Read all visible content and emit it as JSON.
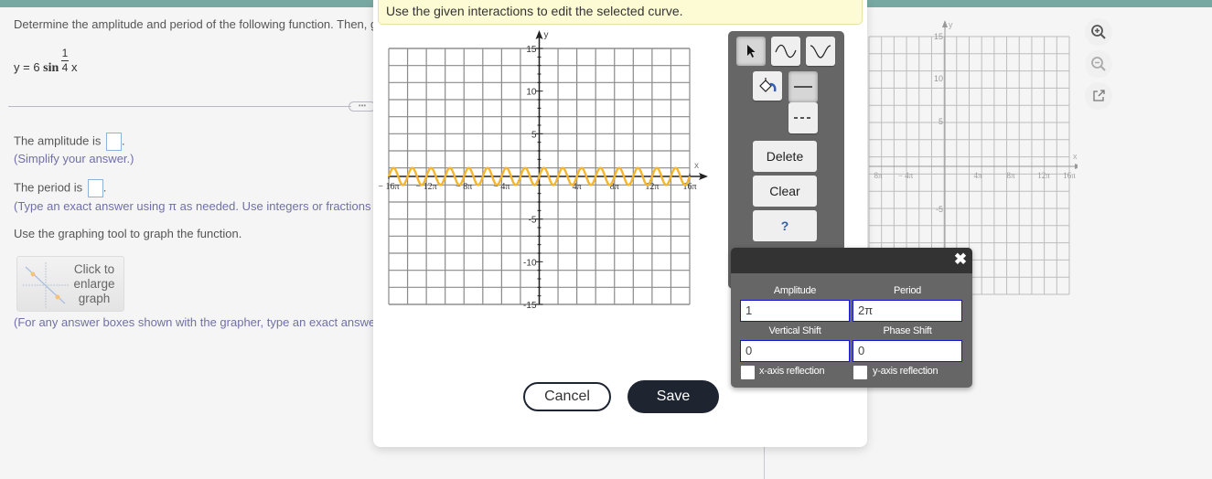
{
  "question": {
    "prompt": "Determine the amplitude and period of the following function. Then, g",
    "equation": {
      "prefix": "y = 6 ",
      "func": "sin",
      "numerator": "1",
      "denominator": "4",
      "variable": "x"
    },
    "amplitude_label": "The amplitude is",
    "amplitude_value": "",
    "amplitude_hint": "(Simplify your answer.)",
    "period_label": "The period is",
    "period_value": "",
    "period_hint": "(Type an exact answer using π as needed. Use integers or fractions",
    "graph_instruction": "Use the graphing tool to graph the function.",
    "enlarge_label": [
      "Click to",
      "enlarge",
      "graph"
    ],
    "grapher_hint": "(For any answer boxes shown with the grapher, type an exact answe",
    "more_label": "•••"
  },
  "modal": {
    "tooltip": "Use the given interactions to edit the selected curve.",
    "cancel_label": "Cancel",
    "save_label": "Save"
  },
  "graph": {
    "x_label": "x",
    "y_label": "y",
    "x_ticks": [
      "− 16π",
      "− 12π",
      "− 8π",
      "− 4π",
      "4π",
      "8π",
      "12π",
      "16π"
    ],
    "x_tick_values_pi": [
      -16,
      -12,
      -8,
      -4,
      4,
      8,
      12,
      16
    ],
    "y_ticks": [
      "15",
      "10",
      "5",
      "-5",
      "-10",
      "-15"
    ],
    "y_tick_values": [
      15,
      10,
      5,
      -5,
      -10,
      -15
    ],
    "x_range_pi": [
      -16,
      16
    ],
    "y_range": [
      -15,
      15
    ],
    "x_grid_step_pi": 2,
    "y_grid_step": 2,
    "curve": {
      "type": "sine",
      "amplitude": 1,
      "period_pi": 2,
      "vertical_shift": 0,
      "phase_shift": 0,
      "color": "#f7b52c"
    }
  },
  "toolbar": {
    "tools": [
      {
        "name": "pointer",
        "selected": true
      },
      {
        "name": "sine",
        "selected": false
      },
      {
        "name": "cosine",
        "selected": false
      }
    ],
    "color_tool": "paint-bucket",
    "line_styles": [
      {
        "name": "solid",
        "selected": true
      },
      {
        "name": "dashed",
        "selected": false
      }
    ],
    "delete_label": "Delete",
    "clear_label": "Clear",
    "help_label": "?"
  },
  "edit_dialog": {
    "close_label": "✖",
    "amplitude_label": "Amplitude",
    "amplitude_value": "1",
    "period_label": "Period",
    "period_value": "2π",
    "vertical_shift_label": "Vertical Shift",
    "vertical_shift_value": "0",
    "phase_shift_label": "Phase Shift",
    "phase_shift_value": "0",
    "x_reflection_label": "x-axis reflection",
    "x_reflection_checked": false,
    "y_reflection_label": "y-axis reflection",
    "y_reflection_checked": false
  },
  "background_graph": {
    "x_ticks": [
      "8π",
      "− 4π",
      "4π",
      "8π",
      "12π",
      "16π"
    ],
    "y_ticks": [
      "15",
      "10",
      "5",
      "-5"
    ],
    "x_label": "x",
    "y_label": "y"
  }
}
